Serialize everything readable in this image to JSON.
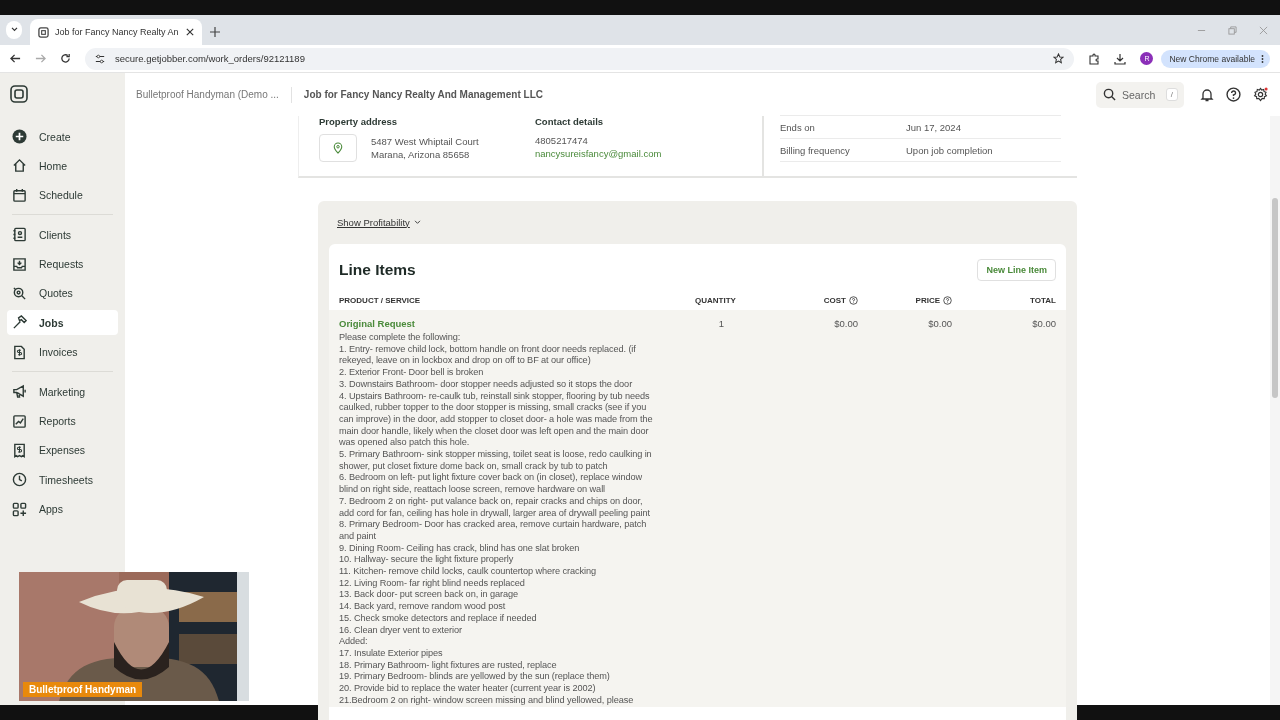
{
  "browser": {
    "tab_title": "Job for Fancy Nancy Realty An",
    "url": "secure.getjobber.com/work_orders/92121189",
    "profile_initial": "R",
    "update_label": "New Chrome available"
  },
  "sidebar": {
    "groups": [
      [
        {
          "label": "Create",
          "selected": false
        },
        {
          "label": "Home",
          "selected": false
        },
        {
          "label": "Schedule",
          "selected": false
        }
      ],
      [
        {
          "label": "Clients",
          "selected": false
        },
        {
          "label": "Requests",
          "selected": false
        },
        {
          "label": "Quotes",
          "selected": false
        },
        {
          "label": "Jobs",
          "selected": true
        },
        {
          "label": "Invoices",
          "selected": false
        }
      ],
      [
        {
          "label": "Marketing",
          "selected": false
        },
        {
          "label": "Reports",
          "selected": false
        },
        {
          "label": "Expenses",
          "selected": false
        },
        {
          "label": "Timesheets",
          "selected": false
        },
        {
          "label": "Apps",
          "selected": false
        }
      ]
    ]
  },
  "header": {
    "account": "Bulletproof Handyman (Demo ...",
    "title": "Job for Fancy Nancy Realty And Management LLC",
    "search": {
      "placeholder": "Search",
      "shortcut": "/"
    }
  },
  "property": {
    "address_label": "Property address",
    "address_lines": [
      "5487 West Whiptail Court",
      "Marana, Arizona 85658"
    ],
    "contact_label": "Contact details",
    "phone": "4805217474",
    "email": "nancysureisfancy@gmail.com"
  },
  "details": [
    {
      "label": "Ends on",
      "value": "Jun 17, 2024"
    },
    {
      "label": "Billing frequency",
      "value": "Upon job completion"
    }
  ],
  "profitability": "Show Profitability",
  "line_items": {
    "title": "Line Items",
    "new_button": "New Line Item",
    "columns": [
      {
        "label": "PRODUCT / SERVICE",
        "info": false
      },
      {
        "label": "QUANTITY",
        "info": false
      },
      {
        "label": "COST",
        "info": true
      },
      {
        "label": "PRICE",
        "info": true
      },
      {
        "label": "TOTAL",
        "info": false
      }
    ],
    "rows": [
      {
        "name": "Original Request",
        "quantity": "1",
        "cost": "$0.00",
        "price": "$0.00",
        "total": "$0.00",
        "description_lines": [
          "Please complete the following:",
          "1. Entry- remove child lock, bottom handle on front door needs replaced. (if",
          "rekeyed, leave on in lockbox and drop on off to BF at our office)",
          "2. Exterior Front- Door bell is broken",
          "3. Downstairs Bathroom- door stopper needs adjusted so it stops the door",
          "4. Upstairs Bathroom- re-caulk tub, reinstall sink stopper, flooring by tub needs",
          "caulked, rubber topper to the door stopper is missing, small cracks (see if you",
          "can improve) in the door, add stopper to closet door- a hole was made from the",
          "main door handle, likely when the closet door was left open and the main door",
          "was opened also patch this hole.",
          "5. Primary Bathroom- sink stopper missing, toilet seat is loose, redo caulking in",
          "shower, put closet fixture dome back on, small crack by tub to patch",
          "6. Bedroom on left- put light fixture cover back on (in closet), replace window",
          "blind on right side, reattach loose screen, remove hardware on wall",
          "7. Bedroom 2 on right- put valance back on, repair cracks and chips on door,",
          "add cord for fan, ceiling has hole in drywall, larger area of drywall peeling paint",
          "8. Primary Bedroom- Door has cracked area, remove curtain hardware, patch",
          "and paint",
          "9. Dining Room- Ceiling has crack, blind has one slat broken",
          "10. Hallway- secure the light fixture properly",
          "11. Kitchen- remove child locks, caulk countertop where cracking",
          "12. Living Room- far right blind needs replaced",
          "13. Back door- put screen back on, in garage",
          "14. Back yard, remove random wood post",
          "15. Check smoke detectors and replace if needed",
          "16. Clean dryer vent to exterior",
          "Added:",
          "17. Insulate Exterior pipes",
          "18. Primary Bathroom- light fixtures are rusted, replace",
          "19. Primary Bedroom- blinds are yellowed by the sun (replace them)",
          "20. Provide bid to replace the water heater (current year is 2002)",
          "21.Bedroom 2 on right- window screen missing and blind yellowed, please"
        ]
      }
    ]
  },
  "webcam": {
    "kind": "picture",
    "caption": "Bulletproof Handyman"
  }
}
